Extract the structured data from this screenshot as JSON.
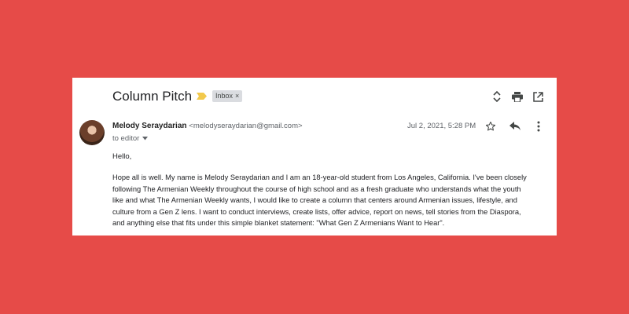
{
  "email": {
    "subject": "Column Pitch",
    "label": "Inbox",
    "label_remove_glyph": "×",
    "sender_name": "Melody Seraydarian",
    "sender_email": "<melodyseraydarian@gmail.com>",
    "recipient_text": "to editor",
    "date": "Jul 2, 2021, 5:28 PM",
    "greeting": "Hello,",
    "body_lines": [
      "Hope all is well. My name is Melody Seraydarian and I am an 18-year-old student from Los Angeles, California. I've been closely",
      "following The Armenian Weekly throughout the course of high school and as a fresh graduate who understands what the youth",
      "like and what The Armenian Weekly wants, I would like to create a column that centers around Armenian issues, lifestyle, and",
      "culture from a Gen Z lens. I want to conduct interviews, create lists, offer advice, report on news, tell stories from the Diaspora,",
      "and anything else that fits under this simple blanket statement: \"What Gen Z Armenians Want to Hear\"."
    ]
  },
  "icons": {
    "important": "important-marker-icon",
    "expand": "unfold-icon",
    "print": "print-icon",
    "open_new": "open-in-new-icon",
    "star": "star-icon",
    "reply": "reply-icon",
    "more": "more-vert-icon",
    "dropdown": "caret-down-icon"
  },
  "colors": {
    "background": "#e64b48",
    "card": "#ffffff",
    "important_marker": "#f2c94c",
    "chip": "#dadce0"
  }
}
